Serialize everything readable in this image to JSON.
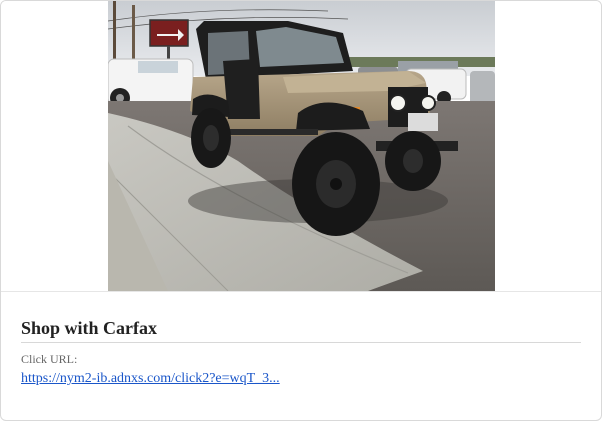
{
  "card": {
    "image_alt": "Tan Jeep CJ with black soft top parked on a sidewalk at a car dealership lot",
    "title": "Shop with Carfax",
    "click_url_label": "Click URL:",
    "click_url": "https://nym2-ib.adnxs.com/click2?e=wqT_3..."
  },
  "colors": {
    "title": "#222222",
    "link": "#1a56c9",
    "label": "#666666"
  }
}
